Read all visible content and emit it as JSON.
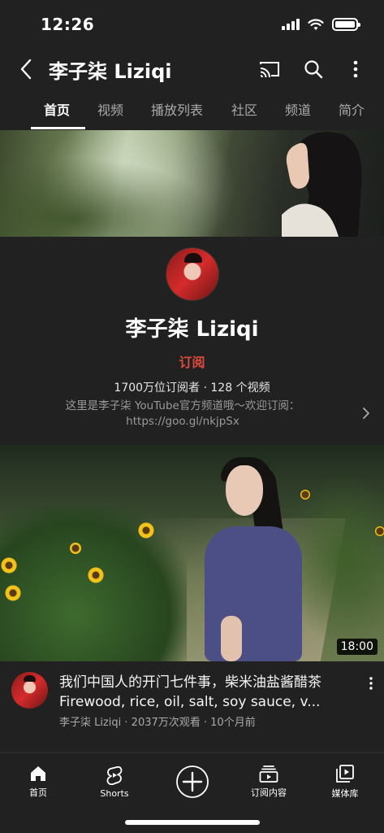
{
  "status_bar": {
    "time": "12:26"
  },
  "app_bar": {
    "title": "李子柒 Liziqi"
  },
  "tabs": [
    {
      "label": "首页",
      "active": true
    },
    {
      "label": "视频",
      "active": false
    },
    {
      "label": "播放列表",
      "active": false
    },
    {
      "label": "社区",
      "active": false
    },
    {
      "label": "频道",
      "active": false
    },
    {
      "label": "简介",
      "active": false
    }
  ],
  "channel": {
    "name": "李子柒 Liziqi",
    "subscribe_label": "订阅",
    "stats": "1700万位订阅者 · 128 个视频",
    "description": "这里是李子柒 YouTube官方频道哦～欢迎订阅：https://goo.gl/nkjpSx"
  },
  "video": {
    "duration": "18:00",
    "title": "我们中国人的开门七件事，柴米油盐酱醋茶 Firewood, rice, oil, salt, soy sauce, v...",
    "channel_line": "李子柒 Liziqi · 2037万次观看 · 10个月前"
  },
  "bottom_nav": [
    {
      "label": "首页",
      "icon": "home-icon"
    },
    {
      "label": "Shorts",
      "icon": "shorts-icon"
    },
    {
      "label": "",
      "icon": "create-icon"
    },
    {
      "label": "订阅内容",
      "icon": "subscriptions-icon"
    },
    {
      "label": "媒体库",
      "icon": "library-icon"
    }
  ],
  "colors": {
    "background": "#212121",
    "subscribe": "#e04a3b",
    "secondary_text": "#aaaaaa"
  }
}
